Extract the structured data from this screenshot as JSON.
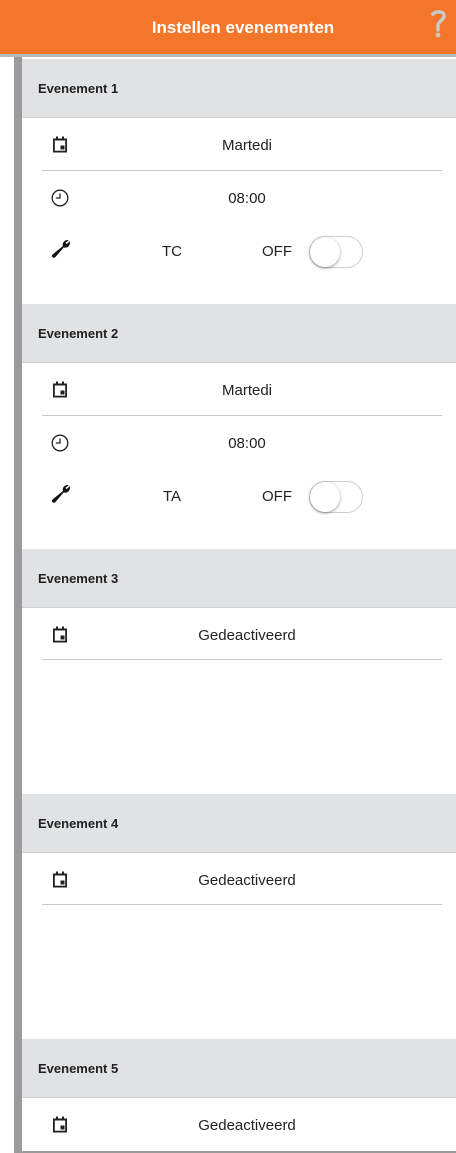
{
  "header": {
    "title": "Instellen evenementen",
    "help_icon": "help-icon"
  },
  "colors": {
    "accent": "#f4762a",
    "section_bg": "#e1e2e3"
  },
  "events": [
    {
      "title": "Evenement 1",
      "day": "Martedi",
      "time": "08:00",
      "tool": "TC",
      "toggle_label": "OFF",
      "toggle_on": false
    },
    {
      "title": "Evenement 2",
      "day": "Martedi",
      "time": "08:00",
      "tool": "TA",
      "toggle_label": "OFF",
      "toggle_on": false
    },
    {
      "title": "Evenement 3",
      "day": "Gedeactiveerd"
    },
    {
      "title": "Evenement 4",
      "day": "Gedeactiveerd"
    },
    {
      "title": "Evenement 5",
      "day": "Gedeactiveerd"
    }
  ],
  "icons": {
    "day": "calendar-icon",
    "time": "clock-icon",
    "tool": "wrench-icon"
  }
}
